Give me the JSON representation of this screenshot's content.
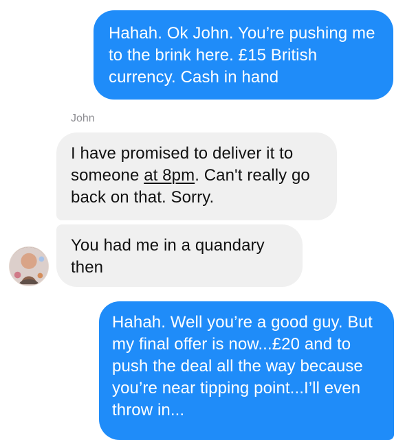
{
  "conversation": {
    "sender_name": "John",
    "messages": [
      {
        "direction": "outgoing",
        "text": "Hahah. Ok John. You’re pushing me to the brink here. £15 British currency. Cash in hand"
      },
      {
        "direction": "incoming",
        "text_before_underline": "I have promised to deliver it to someone ",
        "underlined_text": "at 8pm",
        "text_after_underline": ". Can't really go back on that. Sorry."
      },
      {
        "direction": "incoming",
        "text": "You had me in a quandary then"
      },
      {
        "direction": "outgoing",
        "text": "Hahah. Well you’re a good guy. But my final offer is now...£20 and to push the deal all the way because you’re near tipping point...I’ll even throw in..."
      }
    ]
  },
  "colors": {
    "outgoing_bubble": "#1f8cf9",
    "incoming_bubble": "#f0f0f0",
    "sender_label": "#8e8e93"
  },
  "icons": {
    "avatar": "profile-photo-icon"
  }
}
